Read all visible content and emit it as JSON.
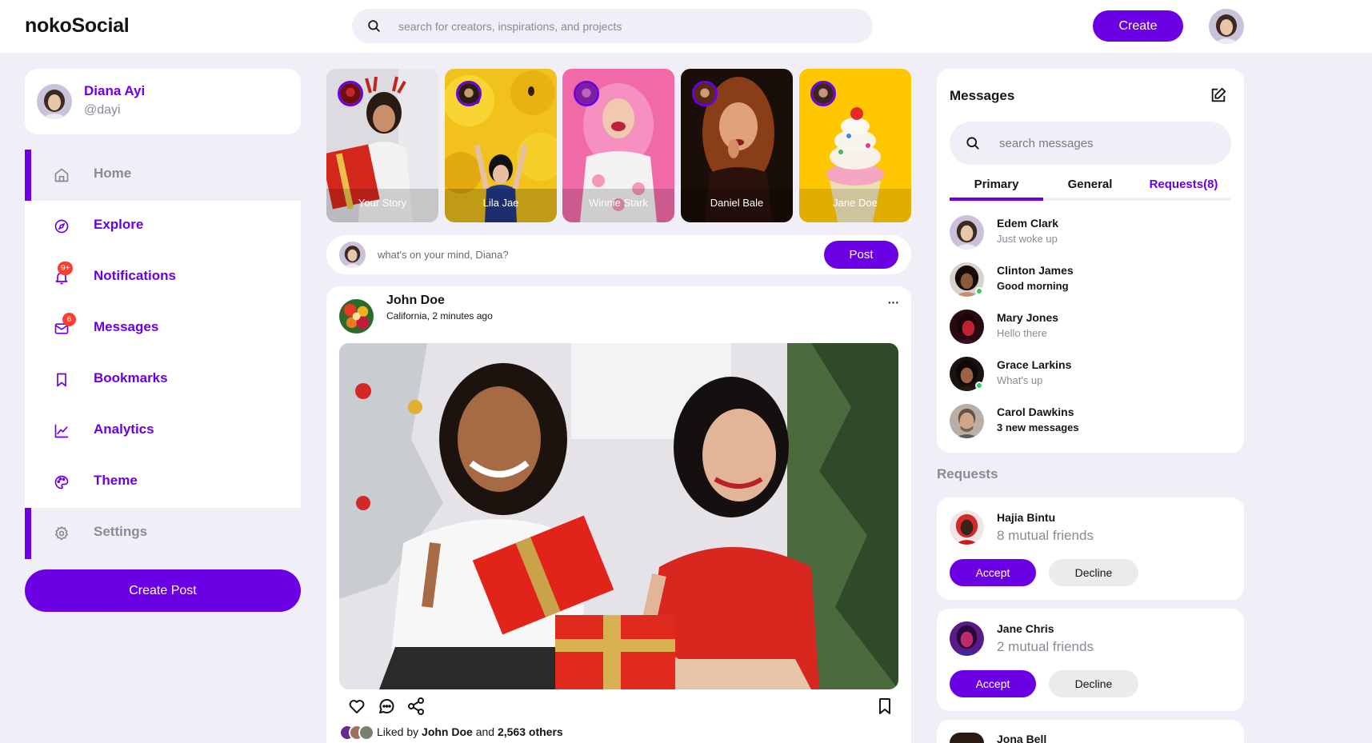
{
  "brand": {
    "logo": "nokoSocial",
    "accent": "#6c00e4"
  },
  "navbar": {
    "search_placeholder": "search for creators, inspirations, and projects",
    "create_label": "Create"
  },
  "profile": {
    "name": "Diana Ayi",
    "handle": "@dayi"
  },
  "sidebar": {
    "items": [
      {
        "label": "Home",
        "icon": "home-icon",
        "active": true
      },
      {
        "label": "Explore",
        "icon": "compass-icon"
      },
      {
        "label": "Notifications",
        "icon": "bell-icon",
        "badge": "9+"
      },
      {
        "label": "Messages",
        "icon": "envelope-icon",
        "badge": "6"
      },
      {
        "label": "Bookmarks",
        "icon": "bookmark-icon"
      },
      {
        "label": "Analytics",
        "icon": "chart-line-icon"
      },
      {
        "label": "Theme",
        "icon": "palette-icon"
      },
      {
        "label": "Settings",
        "icon": "gear-icon",
        "active": true
      }
    ],
    "create_post_label": "Create Post"
  },
  "stories": [
    {
      "name": "Your Story"
    },
    {
      "name": "Lila Jae"
    },
    {
      "name": "Winnie Stark"
    },
    {
      "name": "Daniel Bale"
    },
    {
      "name": "Jane Doe"
    }
  ],
  "composer": {
    "placeholder": "what's on your mind, Diana?",
    "post_label": "Post"
  },
  "feed": {
    "author": "John Doe",
    "meta": "California, 2 minutes ago",
    "more": "···",
    "likes": {
      "prefix": "Liked by",
      "name": "John Doe",
      "joiner": "and",
      "others": "2,563 others"
    }
  },
  "messages": {
    "title": "Messages",
    "search_placeholder": "search messages",
    "tabs": [
      "Primary",
      "General",
      "Requests(8)"
    ],
    "items": [
      {
        "name": "Edem Clark",
        "text": "Just woke up",
        "online": false,
        "unread": false
      },
      {
        "name": "Clinton James",
        "text": "Good morning",
        "online": true,
        "unread": true
      },
      {
        "name": "Mary Jones",
        "text": "Hello there",
        "online": false,
        "unread": false
      },
      {
        "name": "Grace Larkins",
        "text": "What's up",
        "online": true,
        "unread": false
      },
      {
        "name": "Carol Dawkins",
        "text": "3 new messages",
        "online": false,
        "unread": true
      }
    ]
  },
  "requests": {
    "heading": "Requests",
    "accept_label": "Accept",
    "decline_label": "Decline",
    "items": [
      {
        "name": "Hajia Bintu",
        "mutual": "8 mutual friends"
      },
      {
        "name": "Jane Chris",
        "mutual": "2 mutual friends"
      },
      {
        "name": "Jona Bell",
        "mutual": ""
      }
    ]
  }
}
